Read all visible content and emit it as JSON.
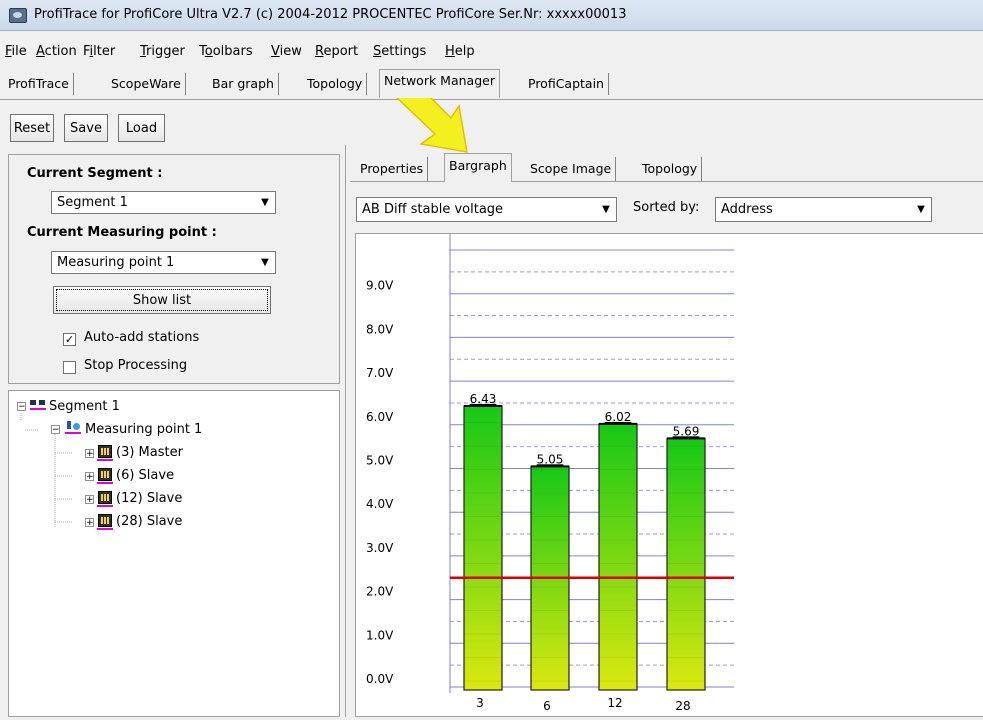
{
  "window": {
    "title": "ProfiTrace for ProfiCore Ultra V2.7 (c) 2004-2012 PROCENTEC  ProfiCore Ser.Nr: xxxxx00013"
  },
  "menu": {
    "items": [
      {
        "label": "File",
        "u": "F",
        "rest": "ile"
      },
      {
        "label": "Action",
        "u": "A",
        "rest": "ction"
      },
      {
        "label": "Filter",
        "pre": "F",
        "u": "i",
        "rest": "lter"
      },
      {
        "label": "Trigger",
        "u": "T",
        "rest": "rigger"
      },
      {
        "label": "Toolbars",
        "pre": "T",
        "u": "o",
        "rest": "olbars"
      },
      {
        "label": "View",
        "u": "V",
        "rest": "iew"
      },
      {
        "label": "Report",
        "u": "R",
        "rest": "eport"
      },
      {
        "label": "Settings",
        "u": "S",
        "rest": "ettings"
      },
      {
        "label": "Help",
        "u": "H",
        "rest": "elp"
      }
    ]
  },
  "top_tabs": [
    "ProfiTrace",
    "ScopeWare",
    "Bar graph",
    "Topology",
    "Network Manager",
    "ProfiCaptain"
  ],
  "top_tabs_active": "Network Manager",
  "toolbar": {
    "reset": "Reset",
    "save": "Save",
    "load": "Load"
  },
  "left": {
    "segment_label": "Current Segment :",
    "segment_value": "Segment 1",
    "mp_label": "Current Measuring point :",
    "mp_value": "Measuring point 1",
    "show_list": "Show list",
    "auto_add": "Auto-add stations",
    "auto_add_checked": true,
    "stop_processing": "Stop Processing",
    "stop_processing_checked": false
  },
  "tree": {
    "root": "Segment 1",
    "child": "Measuring point 1",
    "stations": [
      "(3) Master",
      "(6) Slave",
      "(12) Slave",
      "(28) Slave"
    ]
  },
  "right_tabs": [
    "Properties",
    "Bargraph",
    "Scope Image",
    "Topology"
  ],
  "right_tabs_active": "Bargraph",
  "controls": {
    "measure_value": "AB Diff stable voltage",
    "sorted_label": "Sorted by:",
    "sorted_value": "Address"
  },
  "colors": {
    "bar_top": "#16c816",
    "bar_bottom": "#dde80f",
    "threshold": "#e00000",
    "grid": "#8080e0"
  },
  "chart_data": {
    "type": "bar",
    "categories": [
      "3",
      "6",
      "12",
      "28"
    ],
    "values": [
      6.43,
      5.05,
      6.02,
      5.69
    ],
    "value_labels": [
      "6.43",
      "5.05",
      "6.02",
      "5.69"
    ],
    "yticks": [
      "0.0V",
      "1.0V",
      "2.0V",
      "3.0V",
      "4.0V",
      "5.0V",
      "6.0V",
      "7.0V",
      "8.0V",
      "9.0V"
    ],
    "ylim": [
      0,
      10
    ],
    "threshold": 2.5,
    "grid": true
  }
}
